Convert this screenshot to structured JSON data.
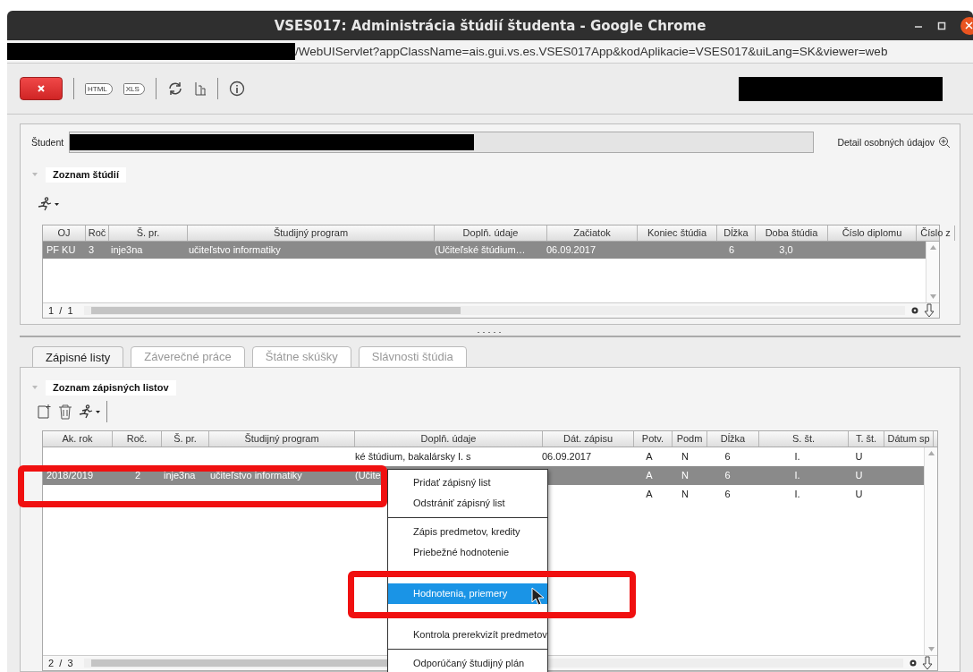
{
  "window": {
    "title": "VSES017: Administrácia štúdií študenta - Google Chrome"
  },
  "address_bar": {
    "url": "/WebUIServlet?appClassName=ais.gui.vs.es.VSES017App&kodAplikacie=VSES017&uiLang=SK&viewer=web"
  },
  "toolbar": {
    "export_buttons": [
      {
        "label": "HTML"
      },
      {
        "label": "XLS"
      }
    ]
  },
  "student": {
    "label": "Študent",
    "detail_link": "Detail osobných údajov"
  },
  "studies": {
    "title": "Zoznam štúdií",
    "columns": [
      {
        "label": "OJ"
      },
      {
        "label": "Roč"
      },
      {
        "label": "Š. pr."
      },
      {
        "label": "Študijný program"
      },
      {
        "label": "Doplň. údaje"
      },
      {
        "label": "Začiatok"
      },
      {
        "label": "Koniec štúdia"
      },
      {
        "label": "Dĺžka"
      },
      {
        "label": "Doba štúdia"
      },
      {
        "label": "Číslo diplomu"
      },
      {
        "label": "Číslo z"
      }
    ],
    "rows": [
      {
        "selected": true,
        "cells": [
          "PF KU",
          "3",
          "inje3na",
          "učiteľstvo informatiky",
          "(Učiteľské štúdium…",
          "06.09.2017",
          null,
          "6",
          "3,0",
          null,
          null
        ]
      }
    ],
    "pager": {
      "page": "1",
      "separator": "/",
      "total": "1"
    }
  },
  "tabs": [
    {
      "label": "Zápisné listy",
      "selected": true
    },
    {
      "label": "Záverečné práce",
      "selected": false
    },
    {
      "label": "Štátne skúšky",
      "selected": false
    },
    {
      "label": "Slávnosti štúdia",
      "selected": false
    }
  ],
  "enrollment": {
    "title": "Zoznam zápisných listov",
    "columns": [
      {
        "label": "Ak. rok"
      },
      {
        "label": "Roč."
      },
      {
        "label": "Š. pr."
      },
      {
        "label": "Študijný program"
      },
      {
        "label": "Doplň. údaje"
      },
      {
        "label": "Dát. zápisu"
      },
      {
        "label": "Potv."
      },
      {
        "label": "Podm"
      },
      {
        "label": "Dĺžka"
      },
      {
        "label": "S. št."
      },
      {
        "label": "T. št."
      },
      {
        "label": "Dátum sp"
      }
    ],
    "rows": [
      {
        "selected": false,
        "cells": [
          null,
          null,
          null,
          null,
          "ké štúdium, bakalársky I. s",
          "06.09.2017",
          "A",
          "N",
          "6",
          "I.",
          "U",
          null
        ]
      },
      {
        "selected": true,
        "cells": [
          "2018/2019",
          "2",
          "inje3na",
          "učiteľstvo informatiky",
          "(Učite",
          null,
          "A",
          "N",
          "6",
          "I.",
          "U",
          null
        ]
      },
      {
        "selected": false,
        "cells": [
          null,
          null,
          null,
          null,
          null,
          null,
          "A",
          "N",
          "6",
          "I.",
          "U",
          null
        ]
      }
    ],
    "pager": {
      "page": "2",
      "separator": "/",
      "total": "3"
    }
  },
  "context_menu": {
    "items": [
      {
        "kind": "item",
        "label": "Pridať zápisný list",
        "highlighted": false
      },
      {
        "kind": "item",
        "label": "Odstrániť zápisný list",
        "highlighted": false
      },
      {
        "kind": "separator"
      },
      {
        "kind": "item",
        "label": "Zápis predmetov, kredity",
        "highlighted": false
      },
      {
        "kind": "item",
        "label": "Priebežné hodnotenie",
        "highlighted": false
      },
      {
        "kind": "obscured"
      },
      {
        "kind": "item",
        "label": "Hodnotenia, priemery",
        "highlighted": true
      },
      {
        "kind": "obscured"
      },
      {
        "kind": "item",
        "label": "Kontrola prerekvizít predmetov",
        "highlighted": false
      },
      {
        "kind": "separator"
      },
      {
        "kind": "item",
        "label": "Odporúčaný študijný plán",
        "highlighted": false
      }
    ]
  }
}
